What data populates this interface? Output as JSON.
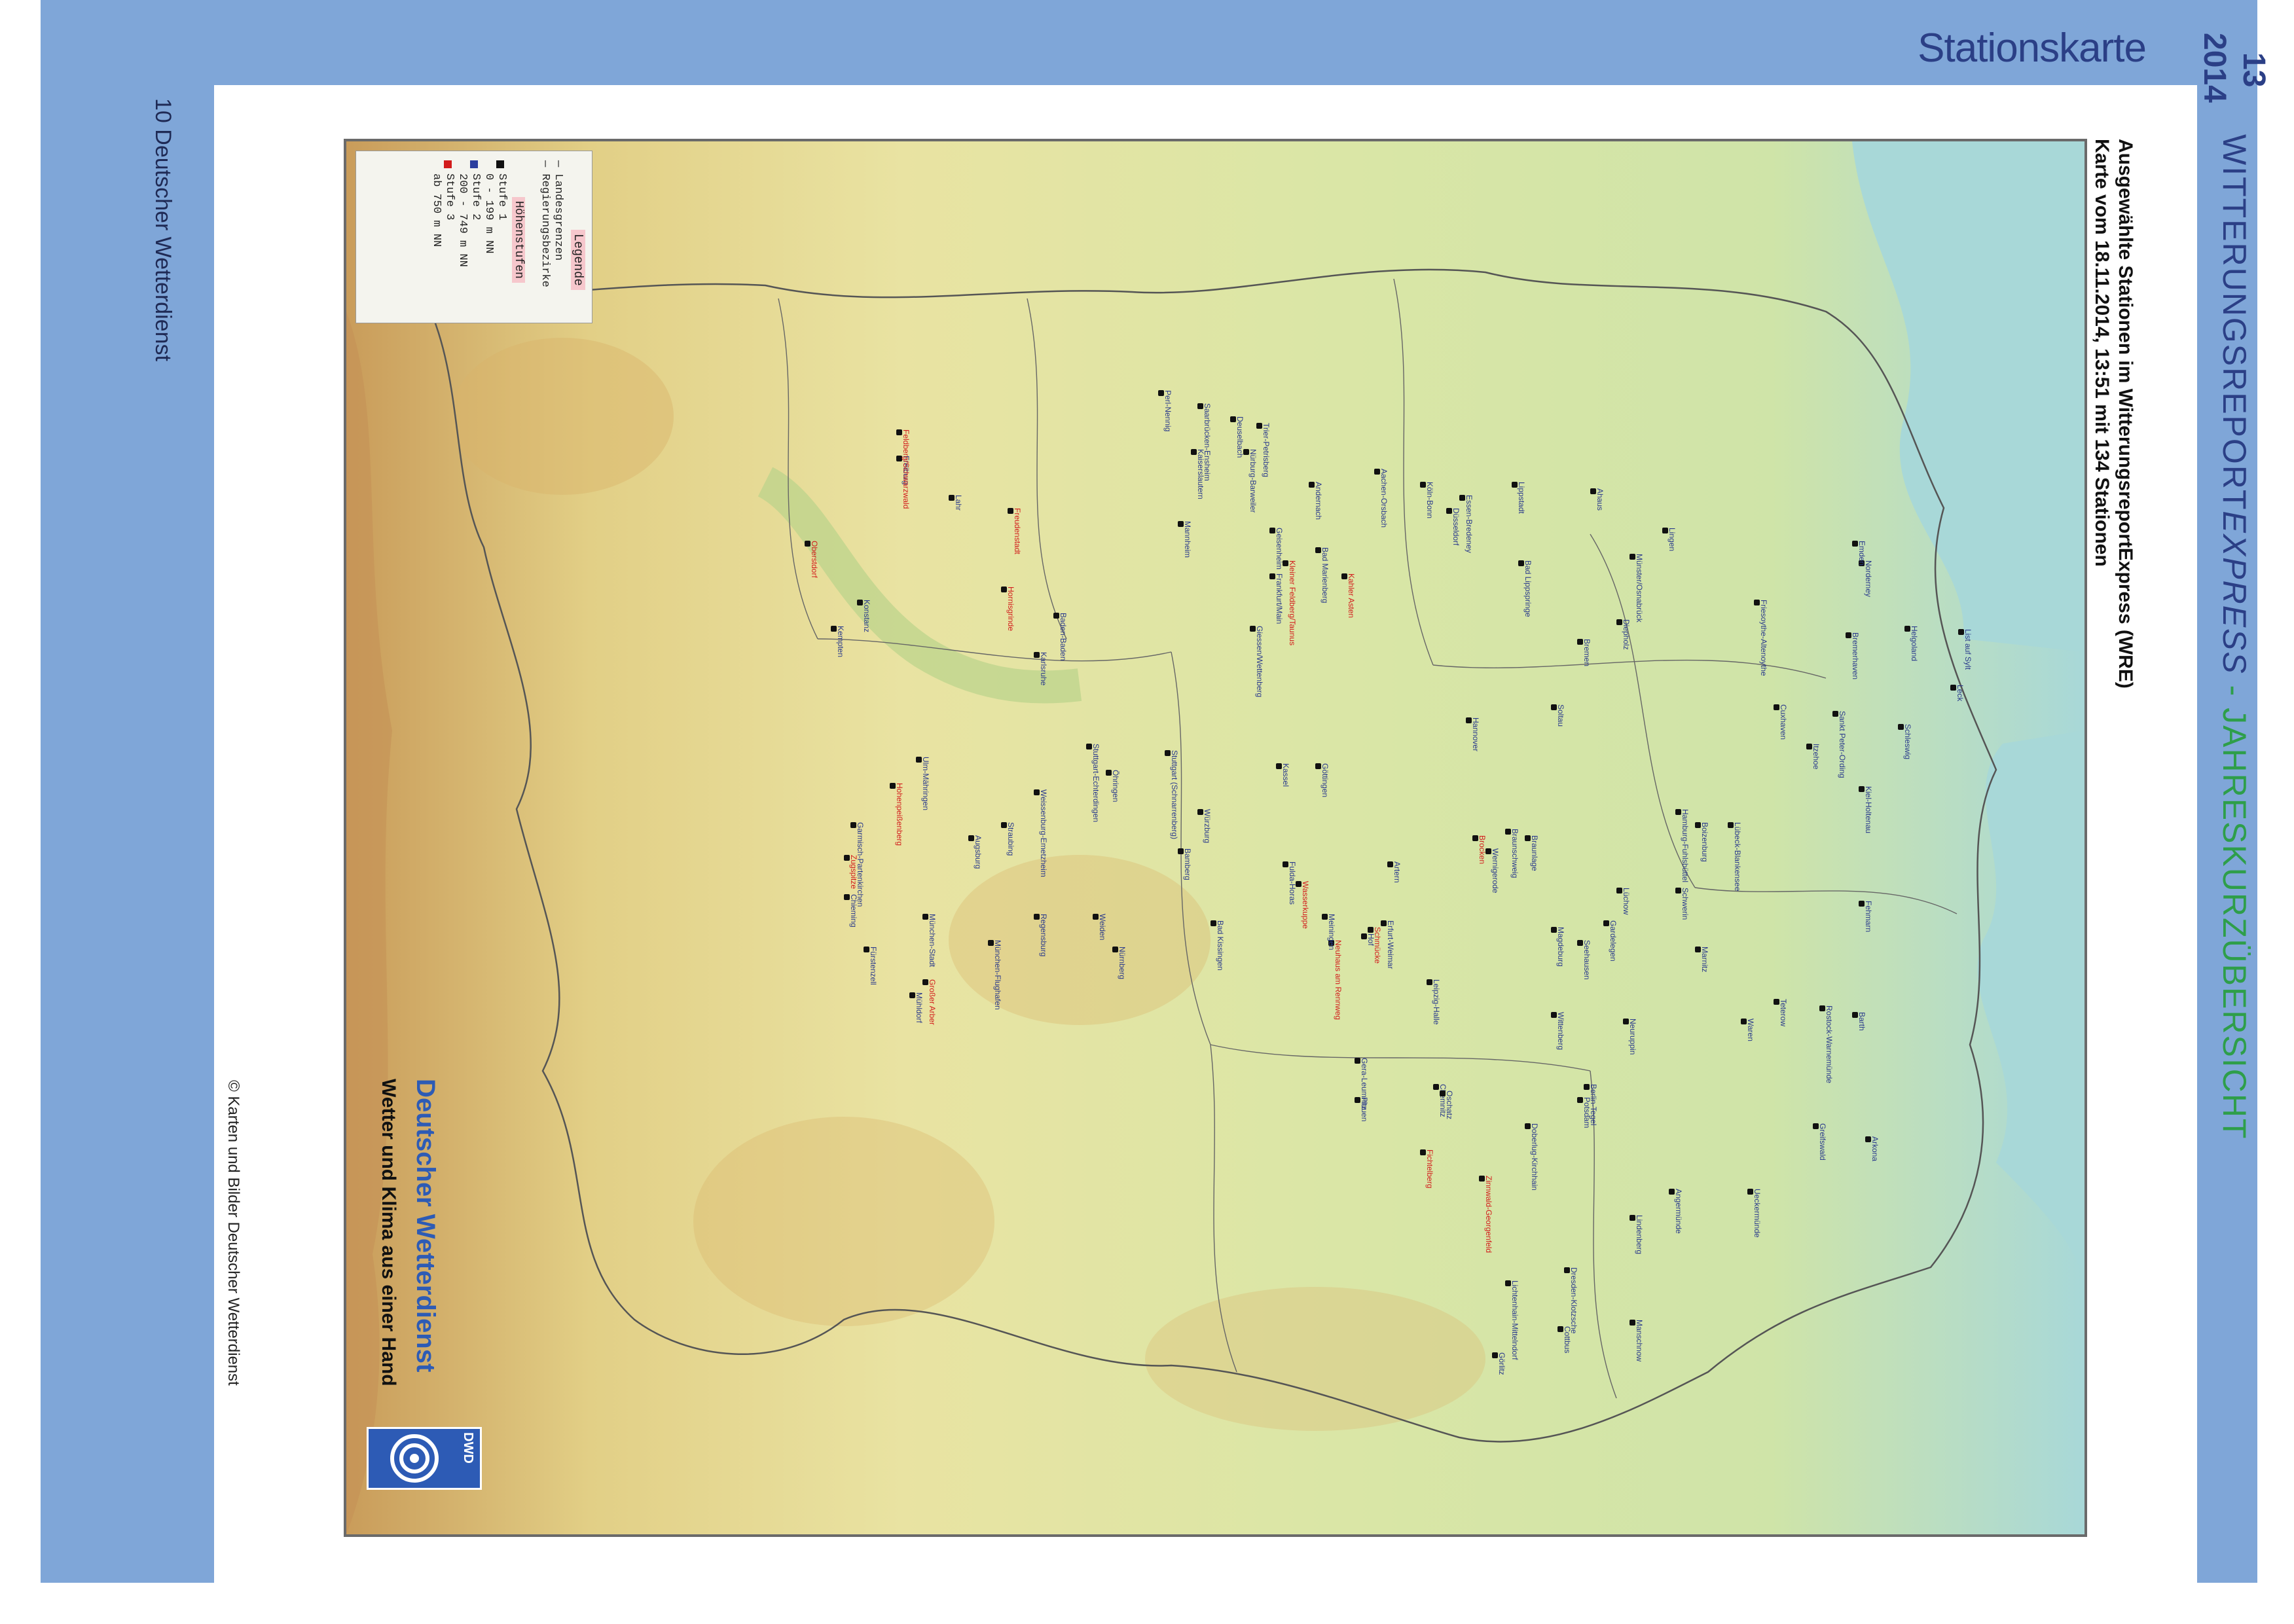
{
  "header": {
    "section_title": "Stationskarte",
    "page_number": "13",
    "year": "2014",
    "report_title_part1": "WITTERUNGSREPORT",
    "report_title_part2": "EXPRESS",
    "report_title_part3": " - JAHRESKURZÜBERSICHT"
  },
  "left_margin": {
    "page_label": "10  Deutscher Wetterdienst",
    "copyright": "© Karten und Bilder Deutscher Wetterdienst"
  },
  "map": {
    "title_line1": "Ausgewählte Stationen im WitterungsreportExpress (WRE)",
    "title_line2": "Karte vom 18.11.2014, 13:51 mit 134 Stationen",
    "legend": {
      "title": "Legende",
      "line1": "— Landesgrenzen",
      "line2": "— Regierungsbezirke",
      "heights_title": "Höhenstufen",
      "levels": [
        {
          "label": "Stufe 1",
          "range": "0 - 199 m NN",
          "color": "#111111"
        },
        {
          "label": "Stufe 2",
          "range": "200 - 749 m NN",
          "color": "#2c3f9e"
        },
        {
          "label": "Stufe 3",
          "range": "ab 750 m NN",
          "color": "#d21c1c"
        }
      ]
    },
    "brand": {
      "name": "Deutscher Wetterdienst",
      "slogan": "Wetter und Klima aus einer Hand",
      "logo_text": "DWD"
    },
    "colors": {
      "sea": "#a8d8d8",
      "lowland": "#cfe4a8",
      "hills": "#e8e1a0",
      "mountains": "#d9b46a"
    },
    "stations": [
      {
        "name": "List auf Sylt",
        "level": 1
      },
      {
        "name": "Leck",
        "level": 1
      },
      {
        "name": "Schleswig",
        "level": 1
      },
      {
        "name": "Kiel-Holtenau",
        "level": 1
      },
      {
        "name": "Fehmarn",
        "level": 1
      },
      {
        "name": "Arkona",
        "level": 1
      },
      {
        "name": "Greifswald",
        "level": 1
      },
      {
        "name": "Barth",
        "level": 1
      },
      {
        "name": "Rostock-Warnemünde",
        "level": 1
      },
      {
        "name": "Teterow",
        "level": 1
      },
      {
        "name": "Ueckermünde",
        "level": 1
      },
      {
        "name": "Angermünde",
        "level": 1
      },
      {
        "name": "Marnitz",
        "level": 1
      },
      {
        "name": "Waren",
        "level": 1
      },
      {
        "name": "Neuruppin",
        "level": 1
      },
      {
        "name": "Lindenberg",
        "level": 1
      },
      {
        "name": "Manschnow",
        "level": 1
      },
      {
        "name": "Cottbus",
        "level": 1
      },
      {
        "name": "Görlitz",
        "level": 1
      },
      {
        "name": "Dresden-Klotzsche",
        "level": 1
      },
      {
        "name": "Lichtenhain-Mittelndorf",
        "level": 1
      },
      {
        "name": "Zinnwald-Georgenfeld",
        "level": 3
      },
      {
        "name": "Fichtelberg",
        "level": 3
      },
      {
        "name": "Chemnitz",
        "level": 2
      },
      {
        "name": "Plauen",
        "level": 2
      },
      {
        "name": "Gera-Leumnitz",
        "level": 2
      },
      {
        "name": "Leipzig-Halle",
        "level": 1
      },
      {
        "name": "Oschatz",
        "level": 1
      },
      {
        "name": "Doberlug-Kirchhain",
        "level": 1
      },
      {
        "name": "Wittenberg",
        "level": 1
      },
      {
        "name": "Berlin-Tegel",
        "level": 1
      },
      {
        "name": "Potsdam",
        "level": 1
      },
      {
        "name": "Magdeburg",
        "level": 1
      },
      {
        "name": "Gardelegen",
        "level": 1
      },
      {
        "name": "Braunlage",
        "level": 2
      },
      {
        "name": "Brocken",
        "level": 3
      },
      {
        "name": "Wernigerode",
        "level": 2
      },
      {
        "name": "Artern",
        "level": 1
      },
      {
        "name": "Erfurt-Weimar",
        "level": 2
      },
      {
        "name": "Schmücke",
        "level": 3
      },
      {
        "name": "Neuhaus am Rennweg",
        "level": 3
      },
      {
        "name": "Meiningen",
        "level": 2
      },
      {
        "name": "Wasserkuppe",
        "level": 3
      },
      {
        "name": "Fulda-Horas",
        "level": 2
      },
      {
        "name": "Kassel",
        "level": 2
      },
      {
        "name": "Göttingen",
        "level": 1
      },
      {
        "name": "Hannover",
        "level": 1
      },
      {
        "name": "Braunschweig",
        "level": 1
      },
      {
        "name": "Soltau",
        "level": 1
      },
      {
        "name": "Bremen",
        "level": 1
      },
      {
        "name": "Hamburg-Fuhlsbüttel",
        "level": 1
      },
      {
        "name": "Lübeck-Blankensee",
        "level": 1
      },
      {
        "name": "Boizenburg",
        "level": 1
      },
      {
        "name": "Schwerin",
        "level": 1
      },
      {
        "name": "Lüchow",
        "level": 1
      },
      {
        "name": "Seehausen",
        "level": 1
      },
      {
        "name": "Cuxhaven",
        "level": 1
      },
      {
        "name": "Itzehoe",
        "level": 1
      },
      {
        "name": "Sankt Peter-Ording",
        "level": 1
      },
      {
        "name": "Helgoland",
        "level": 1
      },
      {
        "name": "Norderney",
        "level": 1
      },
      {
        "name": "Emden",
        "level": 1
      },
      {
        "name": "Bremerhaven",
        "level": 1
      },
      {
        "name": "Friesoythe-Altenoythe",
        "level": 1
      },
      {
        "name": "Diepholz",
        "level": 1
      },
      {
        "name": "Lingen",
        "level": 1
      },
      {
        "name": "Ahaus",
        "level": 1
      },
      {
        "name": "Münster/Osnabrück",
        "level": 1
      },
      {
        "name": "Bad Lippspringe",
        "level": 1
      },
      {
        "name": "Lippstadt",
        "level": 1
      },
      {
        "name": "Essen-Bredeney",
        "level": 1
      },
      {
        "name": "Düsseldorf",
        "level": 1
      },
      {
        "name": "Köln-Bonn",
        "level": 1
      },
      {
        "name": "Aachen-Orsbach",
        "level": 1
      },
      {
        "name": "Kahler Asten",
        "level": 3
      },
      {
        "name": "Giessen/Wettenberg",
        "level": 2
      },
      {
        "name": "Frankfurt/Main",
        "level": 1
      },
      {
        "name": "Kleiner Feldberg/Taunus",
        "level": 3
      },
      {
        "name": "Geisenheim",
        "level": 1
      },
      {
        "name": "Bad Marienberg",
        "level": 2
      },
      {
        "name": "Andernach",
        "level": 1
      },
      {
        "name": "Nürburg-Barweiler",
        "level": 2
      },
      {
        "name": "Trier-Petrisberg",
        "level": 2
      },
      {
        "name": "Deuselbach",
        "level": 2
      },
      {
        "name": "Saarbrücken-Ensheim",
        "level": 2
      },
      {
        "name": "Perl-Nennig",
        "level": 1
      },
      {
        "name": "Kaiserslautern",
        "level": 2
      },
      {
        "name": "Mannheim",
        "level": 1
      },
      {
        "name": "Würzburg",
        "level": 2
      },
      {
        "name": "Bamberg",
        "level": 2
      },
      {
        "name": "Hof",
        "level": 2
      },
      {
        "name": "Bad Kissingen",
        "level": 2
      },
      {
        "name": "Nürnberg",
        "level": 2
      },
      {
        "name": "Weiden",
        "level": 2
      },
      {
        "name": "Regensburg",
        "level": 2
      },
      {
        "name": "Straubing",
        "level": 2
      },
      {
        "name": "Großer Arber",
        "level": 3
      },
      {
        "name": "Fürstenzell",
        "level": 2
      },
      {
        "name": "Weissenburg-Emetzheim",
        "level": 2
      },
      {
        "name": "Öhringen",
        "level": 2
      },
      {
        "name": "Stuttgart (Schnarrenberg)",
        "level": 2
      },
      {
        "name": "Stuttgart-Echterdingen",
        "level": 2
      },
      {
        "name": "Karlsruhe",
        "level": 1
      },
      {
        "name": "Baden-Baden",
        "level": 2
      },
      {
        "name": "Hornisgrinde",
        "level": 3
      },
      {
        "name": "Freudenstadt",
        "level": 3
      },
      {
        "name": "Lahr",
        "level": 1
      },
      {
        "name": "Freiburg",
        "level": 1
      },
      {
        "name": "Feldberg/Schwarzwald",
        "level": 3
      },
      {
        "name": "Konstanz",
        "level": 1
      },
      {
        "name": "Ulm-Mähringen",
        "level": 2
      },
      {
        "name": "Augsburg",
        "level": 2
      },
      {
        "name": "München-Stadt",
        "level": 2
      },
      {
        "name": "München-Flughafen",
        "level": 2
      },
      {
        "name": "Mühldorf",
        "level": 2
      },
      {
        "name": "Chieming",
        "level": 2
      },
      {
        "name": "Kempten",
        "level": 2
      },
      {
        "name": "Zugspitze",
        "level": 3
      },
      {
        "name": "Garmisch-Partenkirchen",
        "level": 2
      },
      {
        "name": "Hohenpeißenberg",
        "level": 3
      },
      {
        "name": "Oberstdorf",
        "level": 3
      }
    ]
  }
}
